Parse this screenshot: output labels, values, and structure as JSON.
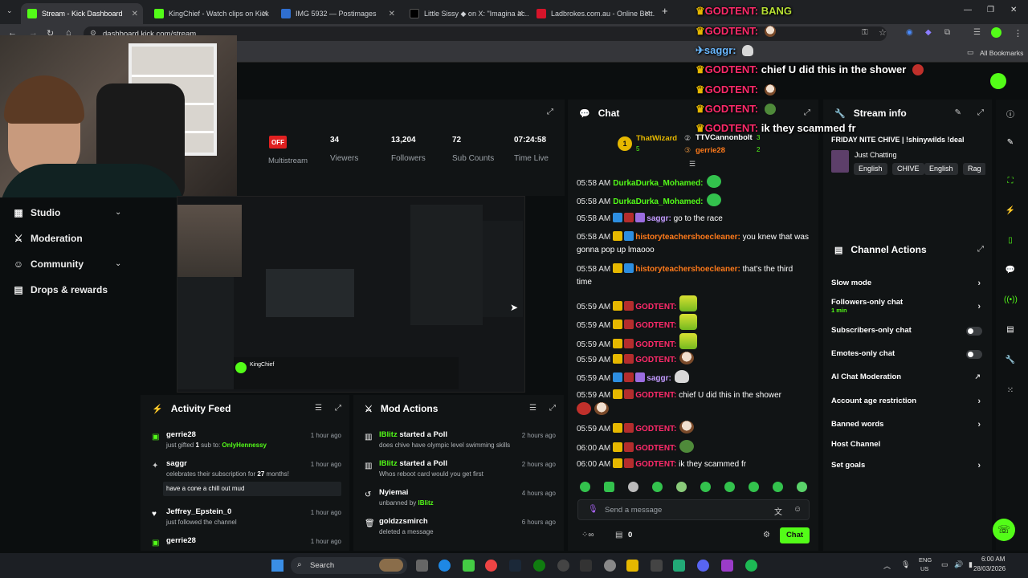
{
  "browser": {
    "tabs": [
      {
        "title": "Stream - Kick Dashboard"
      },
      {
        "title": "KingChief - Watch clips on Kick"
      },
      {
        "title": "IMG 5932 — Postimages"
      },
      {
        "title": "Little Sissy ◆ on X: \"Imagina ac..."
      },
      {
        "title": "Ladbrokes.com.au - Online Bett..."
      }
    ],
    "new_tab": "+",
    "url": "dashboard.kick.com/stream",
    "bookmarks_label": "All Bookmarks"
  },
  "overlay_chat": [
    {
      "user": "GODTENT:",
      "msg": "BANG"
    },
    {
      "user": "GODTENT:",
      "msg": ""
    },
    {
      "user": "saggr:",
      "msg": ""
    },
    {
      "user": "GODTENT:",
      "msg": "chief U did this in the shower"
    },
    {
      "user": "GODTENT:",
      "msg": ""
    },
    {
      "user": "GODTENT:",
      "msg": ""
    },
    {
      "user": "GODTENT:",
      "msg": "ik they scammed fr"
    }
  ],
  "stats": {
    "off_badge": "OFF",
    "multistream": "Multistream",
    "viewers_value": "34",
    "viewers_label": "Viewers",
    "followers_value": "13,204",
    "followers_label": "Followers",
    "subs_value": "72",
    "subs_label": "Sub Counts",
    "time_value": "07:24:58",
    "time_label": "Time Live"
  },
  "nav": {
    "studio": "Studio",
    "moderation": "Moderation",
    "community": "Community",
    "drops": "Drops & rewards"
  },
  "activity": {
    "title": "Activity Feed",
    "items": [
      {
        "name": "gerrie28",
        "sub_pre": "just gifted ",
        "sub_num": "1",
        "sub_mid": " sub to: ",
        "sub_link": "OnlyHennessy",
        "time": "1 hour ago"
      },
      {
        "name": "saggr",
        "sub_pre": "celebrates their subscription for ",
        "sub_num": "27",
        "sub_mid": " months!",
        "sub_link": "",
        "msg": "have a cone a chill out mud",
        "time": "1 hour ago"
      },
      {
        "name": "Jeffrey_Epstein_0",
        "sub_pre": "just followed the channel",
        "time": "1 hour ago"
      },
      {
        "name": "gerrie28",
        "time": "1 hour ago"
      }
    ]
  },
  "mod_actions": {
    "title": "Mod Actions",
    "items": [
      {
        "actor": "IBlitz",
        "action": " started a Poll",
        "detail": "does chive have olympic level swimming skills",
        "time": "2 hours ago"
      },
      {
        "actor": "IBlitz",
        "action": " started a Poll",
        "detail": "Whos reboot card would you get first",
        "time": "2 hours ago"
      },
      {
        "actor": "Nyiemai",
        "action": "",
        "detail": "unbanned by ",
        "detail_link": "IBlitz",
        "time": "4 hours ago"
      },
      {
        "actor": "goldzzsmirch",
        "action": "",
        "detail": "deleted a message",
        "time": "6 hours ago"
      }
    ]
  },
  "chat": {
    "title": "Chat",
    "leaderboard": [
      {
        "rank": "1",
        "name": "ThatWizard",
        "count": "5"
      },
      {
        "name": "TTVCannonbolt",
        "count": "3"
      },
      {
        "name": "gerrie28",
        "count": "2"
      }
    ],
    "messages": [
      {
        "time": "05:58 AM",
        "user": "DurkaDurka_Mohamed:",
        "text": ""
      },
      {
        "time": "05:58 AM",
        "user": "DurkaDurka_Mohamed:",
        "text": ""
      },
      {
        "time": "05:58 AM",
        "user": "saggr:",
        "text": "go to the race"
      },
      {
        "time": "05:58 AM",
        "user": "historyteachershoecleaner:",
        "text": "you knew that was gonna pop up lmaooo"
      },
      {
        "time": "05:58 AM",
        "user": "historyteachershoecleaner:",
        "text": "that's the third time"
      },
      {
        "time": "05:59 AM",
        "user": "GODTENT:",
        "text": ""
      },
      {
        "time": "05:59 AM",
        "user": "GODTENT:",
        "text": ""
      },
      {
        "time": "05:59 AM",
        "user": "GODTENT:",
        "text": ""
      },
      {
        "time": "05:59 AM",
        "user": "GODTENT:",
        "text": ""
      },
      {
        "time": "05:59 AM",
        "user": "saggr:",
        "text": ""
      },
      {
        "time": "05:59 AM",
        "user": "GODTENT:",
        "text": "chief U did this in the shower"
      },
      {
        "time": "05:59 AM",
        "user": "GODTENT:",
        "text": ""
      },
      {
        "time": "06:00 AM",
        "user": "GODTENT:",
        "text": ""
      },
      {
        "time": "06:00 AM",
        "user": "GODTENT:",
        "text": "ik they scammed fr"
      }
    ],
    "input_placeholder": "Send a message",
    "points": "0",
    "send_label": "Chat"
  },
  "stream_info": {
    "title": "Stream info",
    "stream_title": "FRIDAY NITE CHIVE | !shinywilds !deal",
    "category": "Just Chatting",
    "tags": [
      "English",
      "CHIVE",
      "English",
      "Rag"
    ]
  },
  "channel_actions": {
    "title": "Channel Actions",
    "rows": [
      {
        "label": "Slow mode"
      },
      {
        "label": "Followers-only chat",
        "sub": "1 min"
      },
      {
        "label": "Subscribers-only chat"
      },
      {
        "label": "Emotes-only chat"
      },
      {
        "label": "AI Chat Moderation"
      },
      {
        "label": "Account age restriction"
      },
      {
        "label": "Banned words"
      },
      {
        "label": "Host Channel"
      },
      {
        "label": "Set goals"
      }
    ]
  },
  "preview": {
    "channel_name": "KingChief"
  },
  "taskbar": {
    "search": "Search",
    "lang": "ENG",
    "region": "US",
    "time": "6:00 AM",
    "date": "28/03/2026"
  },
  "colors": {
    "accent": "#53fc18",
    "bg": "#0b0e0f",
    "panel": "#111415",
    "live_red": "#e02020"
  }
}
